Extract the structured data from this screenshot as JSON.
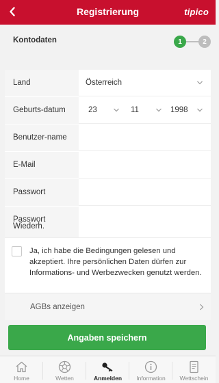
{
  "header": {
    "title": "Registrierung",
    "logo": "tipico",
    "back_icon": "chevron-left-icon",
    "color": "#c8102e"
  },
  "section": {
    "title": "Kontodaten",
    "steps": [
      "1",
      "2"
    ],
    "active_step": 1,
    "active_color": "#3aa84a",
    "inactive_color": "#bdbdbd"
  },
  "form": {
    "land": {
      "label": "Land",
      "value": "Österreich"
    },
    "birth": {
      "label": "Geburts-datum",
      "day": "23",
      "month": "11",
      "year": "1998"
    },
    "username": {
      "label": "Benutzer-name",
      "value": ""
    },
    "email": {
      "label": "E-Mail",
      "value": ""
    },
    "password": {
      "label": "Passwort",
      "value": ""
    },
    "password_repeat": {
      "label_line1": "Passwort",
      "label_line2": "Wiederh.",
      "value": ""
    }
  },
  "consent": {
    "checked": false,
    "text": "Ja, ich habe die Bedingungen gelesen und akzeptiert. Ihre persönlichen Daten dürfen zur Informations- und Werbezwecken genutzt werden."
  },
  "agb": {
    "label": "AGBs anzeigen"
  },
  "save_button": {
    "label": "Angaben speichern",
    "color": "#3aa84a"
  },
  "tabbar": {
    "items": [
      {
        "label": "Home",
        "icon": "home-icon",
        "active": false
      },
      {
        "label": "Wetten",
        "icon": "soccer-ball-icon",
        "active": false
      },
      {
        "label": "Anmelden",
        "icon": "key-icon",
        "active": true
      },
      {
        "label": "Information",
        "icon": "info-icon",
        "active": false
      },
      {
        "label": "Wettschein",
        "icon": "betslip-icon",
        "active": false
      }
    ]
  }
}
